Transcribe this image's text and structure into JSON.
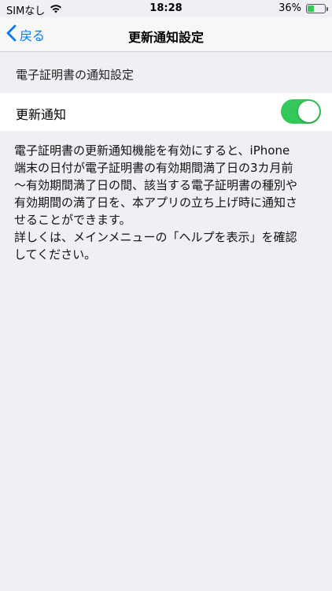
{
  "status_bar": {
    "carrier": "SIMなし",
    "time": "18:28",
    "battery": "36%",
    "battery_level": 0.36
  },
  "nav": {
    "back_label": "戻る",
    "title": "更新通知設定"
  },
  "section": {
    "header": "電子証明書の通知設定"
  },
  "setting": {
    "label": "更新通知",
    "enabled": true
  },
  "description": "電子証明書の更新通知機能を有効にすると、iPhone\n端末の日付が電子証明書の有効期間満了日の3カ月前\n〜有効期間満了日の間、該当する電子証明書の種別や\n有効期間の満了日を、本アプリの立ち上げ時に通知さ\nせることができます。\n詳しくは、メインメニューの「ヘルプを表示」を確認\nしてください。",
  "colors": {
    "accent": "#007aff",
    "toggle_on": "#34c759",
    "background": "#efeff4"
  }
}
